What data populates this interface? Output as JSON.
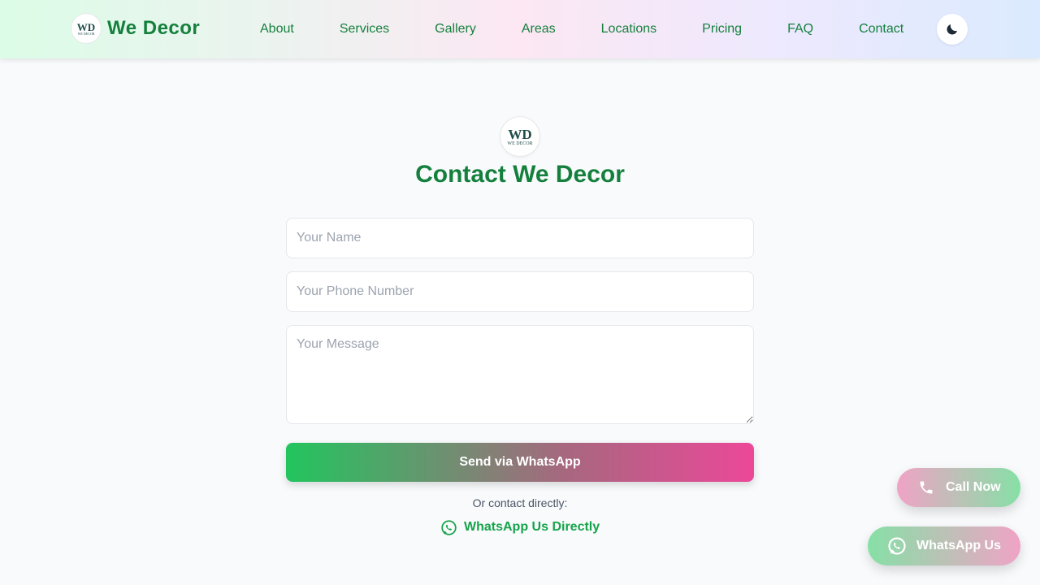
{
  "header": {
    "brand_name": "We Decor",
    "logo_mono": "WD",
    "logo_sub": "WE DECOR",
    "nav": [
      {
        "label": "About"
      },
      {
        "label": "Services"
      },
      {
        "label": "Gallery"
      },
      {
        "label": "Areas"
      },
      {
        "label": "Locations"
      },
      {
        "label": "Pricing"
      },
      {
        "label": "FAQ"
      },
      {
        "label": "Contact"
      }
    ],
    "theme_icon": "moon-icon"
  },
  "main": {
    "logo_mono": "WD",
    "logo_sub": "WE DECOR",
    "title": "Contact We Decor",
    "form": {
      "name_placeholder": "Your Name",
      "phone_placeholder": "Your Phone Number",
      "message_placeholder": "Your Message",
      "submit_label": "Send via WhatsApp"
    },
    "or_text": "Or contact directly:",
    "whatsapp_direct_label": "WhatsApp Us Directly"
  },
  "floating": {
    "call_label": "Call Now",
    "whatsapp_label": "WhatsApp Us"
  },
  "colors": {
    "brand_green": "#15803d",
    "whatsapp_green": "#16a34a",
    "accent_pink": "#ec4899"
  }
}
